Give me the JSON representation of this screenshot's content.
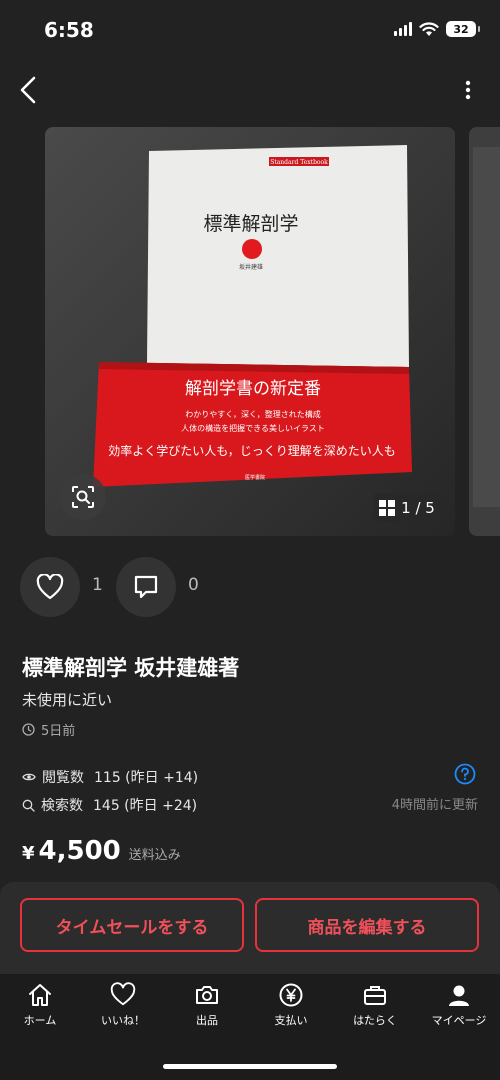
{
  "status_bar": {
    "time": "6:58",
    "battery": "32"
  },
  "carousel": {
    "image_counter": "1 / 5",
    "book": {
      "series": "Standard Textbook",
      "title": "標準解剖学",
      "author": "坂井建雄",
      "band_headline": "解剖学書の新定番",
      "band_line1": "わかりやすく，深く，整理された構成",
      "band_line2": "人体の構造を把握できる美しいイラスト",
      "band_line3": "効率よく学びたい人も，じっくり理解を深めたい人も",
      "publisher": "医学書院"
    }
  },
  "actions": {
    "like_count": "1",
    "comment_count": "0"
  },
  "item": {
    "title": "標準解剖学 坂井建雄著",
    "condition": "未使用に近い",
    "posted": "5日前",
    "views_label": "閲覧数",
    "views_value": "115 (昨日 +14)",
    "searches_label": "検索数",
    "searches_value": "145 (昨日 +24)",
    "updated": "4時間前に更新",
    "price_symbol": "¥",
    "price": "4,500",
    "shipping": "送料込み"
  },
  "buttons": {
    "time_sale": "タイムセールをする",
    "edit_item": "商品を編集する"
  },
  "tabs": [
    {
      "label": "ホーム",
      "icon": "home-icon"
    },
    {
      "label": "いいね！",
      "icon": "heart-icon"
    },
    {
      "label": "出品",
      "icon": "camera-icon"
    },
    {
      "label": "支払い",
      "icon": "yen-icon"
    },
    {
      "label": "はたらく",
      "icon": "briefcase-icon"
    },
    {
      "label": "マイページ",
      "icon": "person-icon"
    }
  ],
  "colors": {
    "accent": "#e6323c",
    "background": "#222222",
    "link": "#1a8cff"
  }
}
